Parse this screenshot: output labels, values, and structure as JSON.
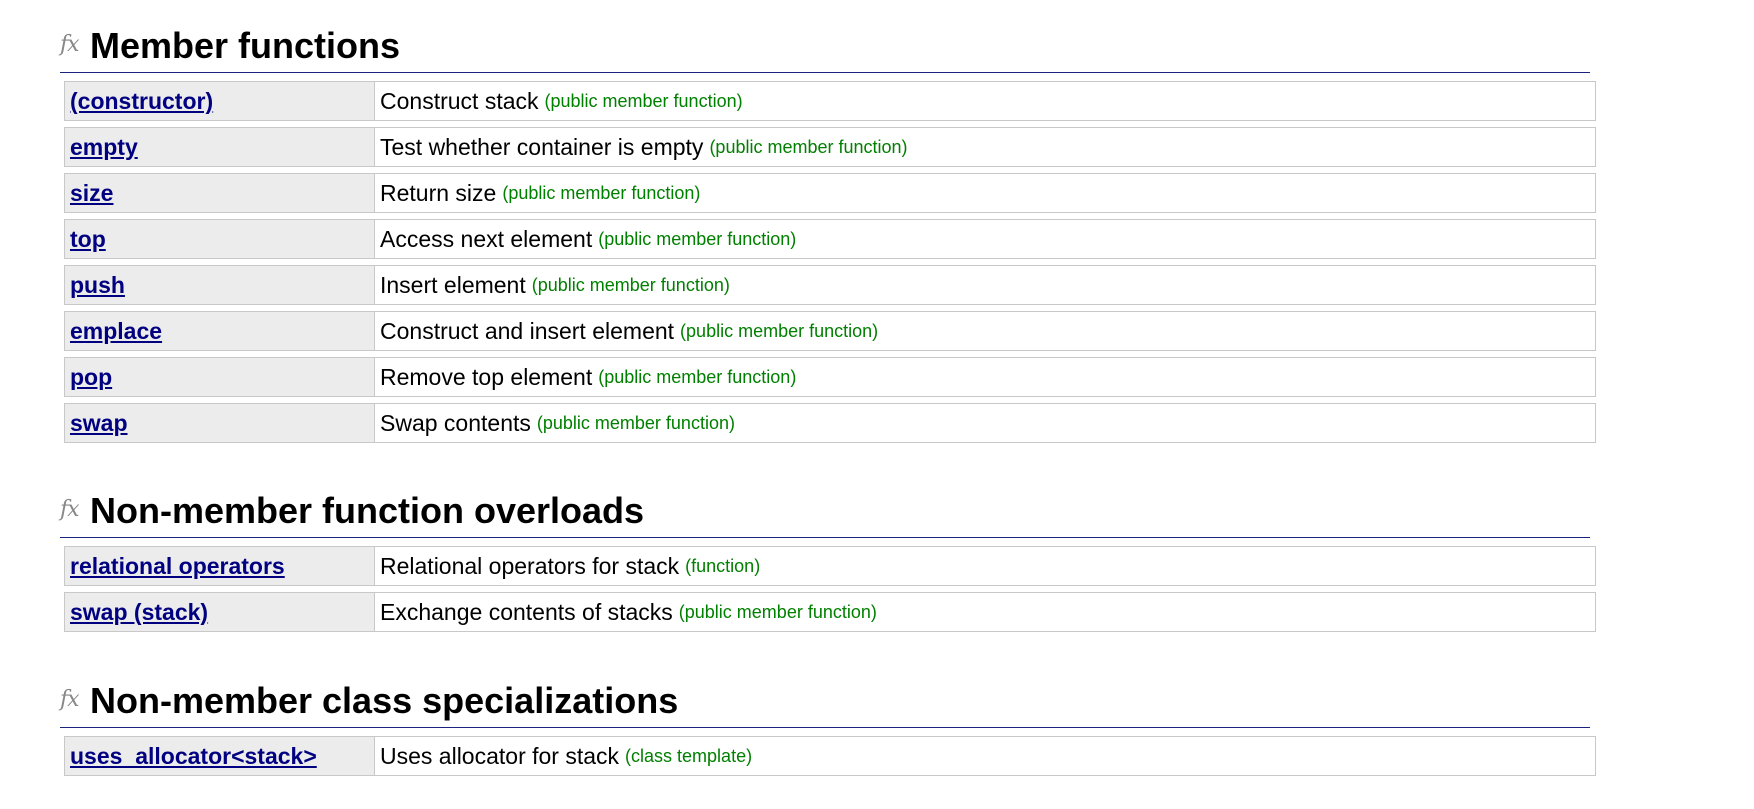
{
  "sections": [
    {
      "fx_icon": "fx",
      "title": "Member functions",
      "rows": [
        {
          "name": "(constructor)",
          "desc": "Construct stack",
          "kind": "(public member function)"
        },
        {
          "name": "empty",
          "desc": "Test whether container is empty",
          "kind": "(public member function)"
        },
        {
          "name": "size",
          "desc": "Return size",
          "kind": "(public member function)"
        },
        {
          "name": "top",
          "desc": "Access next element",
          "kind": "(public member function)"
        },
        {
          "name": "push",
          "desc": "Insert element",
          "kind": "(public member function)"
        },
        {
          "name": "emplace",
          "desc": "Construct and insert element",
          "kind": "(public member function)"
        },
        {
          "name": "pop",
          "desc": "Remove top element",
          "kind": "(public member function)"
        },
        {
          "name": "swap",
          "desc": "Swap contents",
          "kind": "(public member function)"
        }
      ]
    },
    {
      "fx_icon": "fx",
      "title": "Non-member function overloads",
      "rows": [
        {
          "name": "relational operators",
          "desc": "Relational operators for stack",
          "kind": "(function)"
        },
        {
          "name": "swap (stack)",
          "desc": "Exchange contents of stacks",
          "kind": "(public member function)"
        }
      ]
    },
    {
      "fx_icon": "fx",
      "title": "Non-member class specializations",
      "rows": [
        {
          "name": "uses_allocator<stack>",
          "desc": "Uses allocator for stack",
          "kind": "(class template)"
        }
      ]
    }
  ],
  "colors": {
    "link": "#000080",
    "kind": "#008000",
    "rule": "#1a237e",
    "name_cell_bg": "#ececec",
    "border": "#c8c8c8"
  }
}
